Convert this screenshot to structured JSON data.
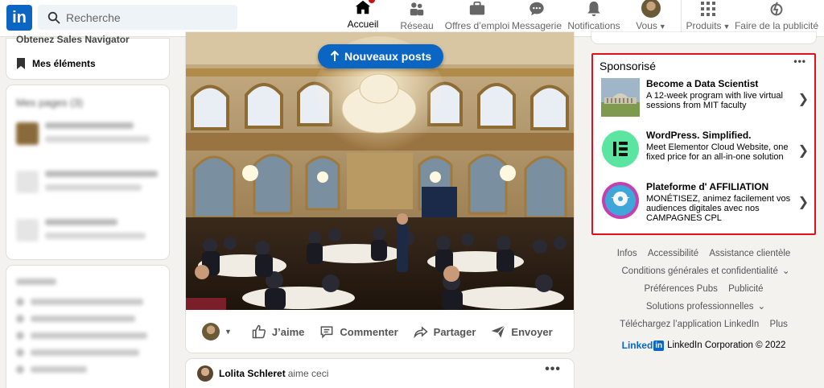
{
  "nav": {
    "logo": "in",
    "search_placeholder": "Recherche",
    "items": [
      {
        "label": "Accueil"
      },
      {
        "label": "Réseau"
      },
      {
        "label": "Offres d’emploi"
      },
      {
        "label": "Messagerie"
      },
      {
        "label": "Notifications"
      },
      {
        "label": "Vous"
      },
      {
        "label": "Produits"
      },
      {
        "label": "Faire de la publicité"
      }
    ]
  },
  "left": {
    "cutoff_text": "Obtenez Sales Navigator",
    "saved_items": "Mes éléments",
    "pages_title": "Mes pages (3)"
  },
  "feed": {
    "new_posts": "Nouveaux posts",
    "actions": [
      {
        "label": "J’aime"
      },
      {
        "label": "Commenter"
      },
      {
        "label": "Partager"
      },
      {
        "label": "Envoyer"
      }
    ],
    "next_post_user": "Lolita Schleret",
    "next_post_action": "aime ceci"
  },
  "sponsored": {
    "title": "Sponsorisé",
    "ads": [
      {
        "title": "Become a Data Scientist",
        "desc": "A 12-week program with live virtual sessions from MIT faculty",
        "icon": "mit-building-thumbnail"
      },
      {
        "title": "WordPress. Simplified.",
        "desc": "Meet Elementor Cloud Website, one fixed price for an all-in-one solution",
        "icon": "elementor-logo"
      },
      {
        "title": "Plateforme d' AFFILIATION",
        "desc": "MONÉTISEZ, animez facilement vos audiences digitales avec nos CAMPAGNES CPL",
        "icon": "affiliation-logo"
      }
    ]
  },
  "footer": {
    "row1": [
      "Infos",
      "Accessibilité",
      "Assistance clientèle"
    ],
    "row2": "Conditions générales et confidentialité",
    "row3": [
      "Préférences Pubs",
      "Publicité"
    ],
    "row4": "Solutions professionnelles",
    "row5": [
      "Téléchargez l’application LinkedIn",
      "Plus"
    ],
    "brand_text": "Linked",
    "brand_box": "in",
    "copyright": "LinkedIn Corporation © 2022"
  },
  "colors": {
    "accent": "#0a66c2",
    "highlight_border": "#e0111c",
    "notification": "#cc1016",
    "elementor": "#92003b"
  }
}
